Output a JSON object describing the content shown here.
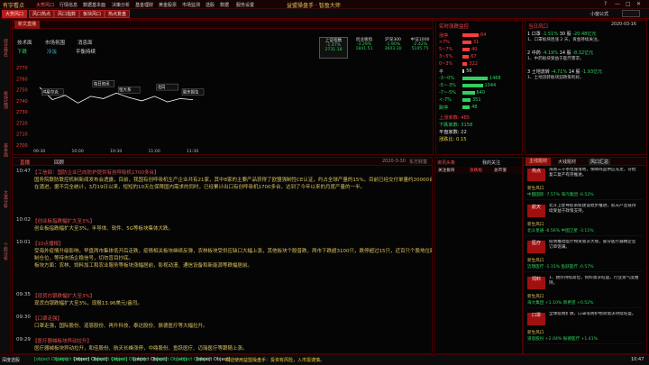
{
  "menubar": {
    "logo": "有宇看点",
    "items": [
      "大势风口",
      "行情信息",
      "数据基本面",
      "决策分析",
      "基金理财",
      "黄金股票",
      "市场监测",
      "选股",
      "数据",
      "服务设置"
    ],
    "title": "益盟操盘手 · 智盈大师",
    "controls": [
      "?",
      "—",
      "□",
      "✕"
    ]
  },
  "toolbar": {
    "buttons": [
      "大势风口",
      "风口热点",
      "风口指数",
      "板块风口",
      "热点复盘"
    ],
    "right_label": "小窗公式"
  },
  "leftstrip": [
    "综合排名",
    "板块监测",
    "基本面",
    "大盘分析",
    "个股分析"
  ],
  "chartpanel": {
    "tab": "新文直播",
    "tags": [
      {
        "label": "技术面",
        "value": "下跌"
      },
      {
        "label": "市场氛围",
        "value": "冷淡"
      },
      {
        "label": "消息面",
        "value": "平衡持续"
      }
    ],
    "indices": [
      {
        "name": "上证指数",
        "value": "2731.18",
        "change": "-1.47%"
      },
      {
        "name": "创业板指",
        "value": "1841.51",
        "change": "-3.29%"
      },
      {
        "name": "沪深300",
        "value": "3603.30",
        "change": "-1.90%"
      },
      {
        "name": "中证1000",
        "value": "5105.75",
        "change": "-2.42%"
      }
    ],
    "yticks": [
      "2770",
      "2760",
      "2750",
      "2740",
      "2730",
      "2720",
      "2710",
      "2700"
    ],
    "xticks": [
      "09:30",
      "10:00",
      "10:30",
      "11:00",
      "11:30"
    ],
    "annotations": [
      "鸿星尔克",
      "每日资讯",
      "恒大系",
      "北向",
      "股东报告"
    ]
  },
  "chart_data": {
    "type": "line",
    "x": [
      "09:30",
      "09:40",
      "09:50",
      "10:00",
      "10:10",
      "10:20",
      "10:30",
      "10:40",
      "10:50",
      "11:00",
      "11:10",
      "11:20",
      "11:30"
    ],
    "series": [
      {
        "values": [
          2752,
          2741,
          2745,
          2738,
          2744,
          2742,
          2747,
          2743,
          2740,
          2744,
          2739,
          2742,
          2741
        ]
      }
    ],
    "ylim": [
      2700,
      2770
    ]
  },
  "market": {
    "title": "实时涨跌监控",
    "rows": [
      {
        "label": "涨停",
        "value": "64",
        "color": "#ff3b3b",
        "pct": 0.4
      },
      {
        "label": ">7%",
        "value": "31",
        "color": "#ff3b3b",
        "pct": 0.22
      },
      {
        "label": "5~7%",
        "value": "40",
        "color": "#ff3b3b",
        "pct": 0.18
      },
      {
        "label": "3~5%",
        "value": "67",
        "color": "#ff3b3b",
        "pct": 0.16
      },
      {
        "label": "0~3%",
        "value": "322",
        "color": "#ff3b3b",
        "pct": 0.12
      },
      {
        "label": "平",
        "value": "56",
        "color": "#ccc",
        "pct": 0.05
      },
      {
        "label": "-3~0%",
        "value": "1468",
        "color": "#30d060",
        "pct": 0.62
      },
      {
        "label": "-5~-3%",
        "value": "1044",
        "color": "#30d060",
        "pct": 0.5
      },
      {
        "label": "-7~-5%",
        "value": "640",
        "color": "#30d060",
        "pct": 0.3
      },
      {
        "label": "<-7%",
        "value": "351",
        "color": "#30d060",
        "pct": 0.2
      },
      {
        "label": "跌停",
        "value": "48",
        "color": "#30d060",
        "pct": 0.18
      }
    ],
    "summary": [
      {
        "label": "上涨家数:",
        "value": "485"
      },
      {
        "label": "下跌家数:",
        "value": "3158"
      },
      {
        "label": "平盘家数:",
        "value": "22"
      },
      {
        "label": "涨跌比:",
        "value": "0.15"
      }
    ]
  },
  "hotspot": {
    "title": "当日风口",
    "date": "2020-03-16",
    "items": [
      {
        "rank": "1",
        "name": "口罩",
        "change": "-1.51%",
        "amount": "30 股",
        "net": "-20.48亿元",
        "desc": "1、口罩板块连涨 2 天，资金持续关注。"
      },
      {
        "rank": "2",
        "name": "中药",
        "change": "-4.19%",
        "amount": "14 股",
        "net": "-8.32亿元",
        "desc": "1、中药板块受益于医疗需求。"
      },
      {
        "rank": "3",
        "name": "土地流转",
        "change": "-4.71%",
        "amount": "14 股",
        "net": "-1.93亿元",
        "desc": "1、土地流转板块迎政策利好。"
      }
    ]
  },
  "news": {
    "tabs": [
      "直播",
      "回顾"
    ],
    "date": "2020-3-30",
    "source": "东方财富",
    "rows": [
      {
        "time": "10:47",
        "title": "【工信部：国防企业已向防护提供有创呼吸机1700多台】",
        "body": "国务院联防联控机制新闻发布会透露，目前，我国有创呼吸机生产企业共有21家，其中8家的主要产品获得了欧盟强制性CE认证，约占全球产量的15%，目前已经交付单量约20000台。同时，每天还有大量的国际订单在涌进，据不完全统计，3月19日以来，短短的10天在保障国内需求的同时，已经累计出口有创呼吸机1700多台，达到了今年以来的月度产量的一半。",
        "likes": "0"
      },
      {
        "time": "10:02",
        "title": "【创业板指跌幅扩大至3%】",
        "body": "创业板指跌幅扩大至3%，半导体、软件、5G等板块集体大跌。",
        "likes": "0"
      },
      {
        "time": "10:01",
        "title": "【10点播报】",
        "body": "受海外疫情升级影响，早盘两市集体低开后走跌，疫情相关板块继续反弹，农林板块受供应缺口大幅上涨，其他板块个股普跌，两市下跌超3100只，跌停超过15只，近百只个股地位跌停，北上资金小幅流入。操作上控制仓位，等待市场企稳信号，切勿盲目抄底。\n板块方面：农林、饲料加工和农业服务等板块涨幅居前，影视动漫、通信设备和新能源等跌幅居前。",
        "likes": "0"
      },
      {
        "time": "09:35",
        "title": "【现货白银跌幅扩大至3%】",
        "body": "现货白银跌幅扩大至3%，现报13.96美元/盎司。",
        "likes": "0"
      },
      {
        "time": "09:30",
        "title": "【口罩走强】",
        "body": "口罩走强，国际股份、道恩股份、再升科技、泰达股份、振德医疗等大幅拉升。",
        "likes": "0"
      },
      {
        "time": "09:29",
        "title": "【医疗器械板块异动拉升】",
        "body": "医疗器械板块异动拉升，和佳股份、航天长峰涨停，中鼎股份、鱼跃医疗、迈瑞医疗等跟随上涨。",
        "likes": "0"
      }
    ]
  },
  "midpanel": {
    "title": "资讯头条",
    "tabs": [
      "我的关注",
      "关注板块",
      "涨跌幅",
      "总市值"
    ]
  },
  "rightpanel": {
    "tabs": [
      "主线题材",
      "大钱题材",
      "风口汇总"
    ],
    "cards": [
      {
        "label": "热点",
        "text": "海南三十条措施落地，保障商品供应充足，分批复工复产有序推进。",
        "m1": "新生风口",
        "m2": "中国国际 -7.57%  海汽集团 -6.52%"
      },
      {
        "label": "航天",
        "text": "北斗卫星导航系统建设稳步推进，航天产业链持续受益于政策支持。",
        "m1": "新生风口",
        "m2": "北斗星通 -6.56%  中国卫星 -3.11%"
      },
      {
        "label": "医疗",
        "text": "疫情推动医疗物资需求大增，部分医疗器械企业订单饱满。",
        "m1": "新生风口",
        "m2": "迈瑞医疗 -1.15%  鱼跃医疗 -0.57%"
      },
      {
        "label": "饲料",
        "text": "1、猪价持续高位，饲料需求旺盛，行业景气度维持。",
        "m1": "新生风口",
        "m2": "海大集团 +1.10%  新希望 +0.52%"
      },
      {
        "label": "口罩",
        "text": "全球疫情扩散，口罩等防护物资需求持续旺盛。",
        "m1": "新生风口",
        "m2": "道恩股份 +2.04%  振德医疗 +1.41%"
      }
    ]
  },
  "statusbar": {
    "left": "深度选股",
    "items": [
      {
        "text": "2731.18",
        "cls": "green"
      },
      {
        "text": "-40.71",
        "cls": "green"
      },
      {
        "text": "1433亿",
        "cls": "white"
      },
      {
        "text": "6711",
        "cls": "green"
      },
      {
        "text": "-124.28",
        "cls": "green"
      },
      {
        "text": "1960亿",
        "cls": "white"
      },
      {
        "text": "1841.51",
        "cls": "green"
      },
      {
        "text": "-62.57",
        "cls": "green"
      },
      {
        "text": "2231亿",
        "cls": "white"
      }
    ],
    "ticker": "欢迎使用益盟操盘手：投资有风险，入市需谨慎。",
    "right": "10:47"
  }
}
